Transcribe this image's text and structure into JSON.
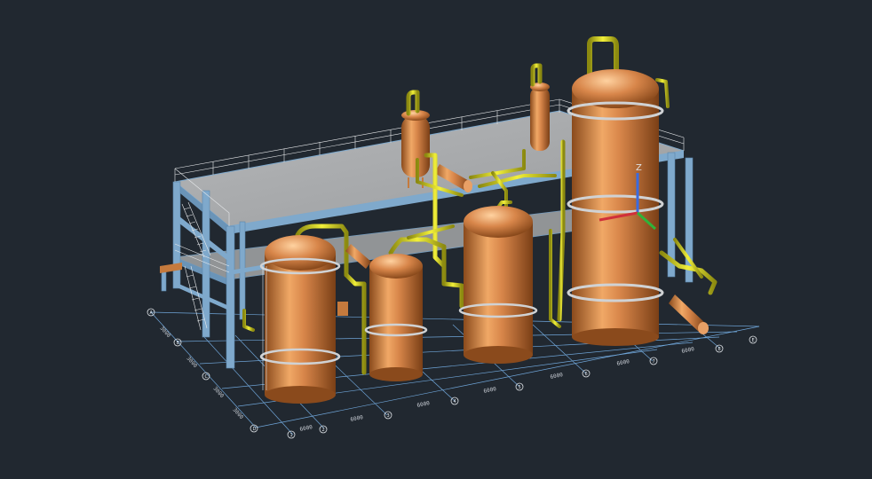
{
  "viewport": {
    "background": "#212830"
  },
  "colors": {
    "vessel": "#c57a3d",
    "pipe": "#d8d61c",
    "steel": "#7fa9cc",
    "deck": "#a9abad",
    "railing": "#e8eaec",
    "grid": "#6fa5d8",
    "ucs_x": "#d0303a",
    "ucs_y": "#2fb43a",
    "ucs_z": "#3a6be0"
  },
  "ucs": {
    "z_label": "Z",
    "icon": "ucs-axis-icon"
  },
  "grid_bubbles_front": [
    "1",
    "2",
    "3",
    "4",
    "5",
    "6",
    "7",
    "8"
  ],
  "grid_bubbles_side": [
    "A",
    "B",
    "C",
    "D",
    "E"
  ],
  "dimension_labels": [
    "6000",
    "6000",
    "6000",
    "6000",
    "6000",
    "6000",
    "6000"
  ],
  "side_dimension_labels": [
    "3000",
    "3000",
    "3000",
    "3000"
  ]
}
